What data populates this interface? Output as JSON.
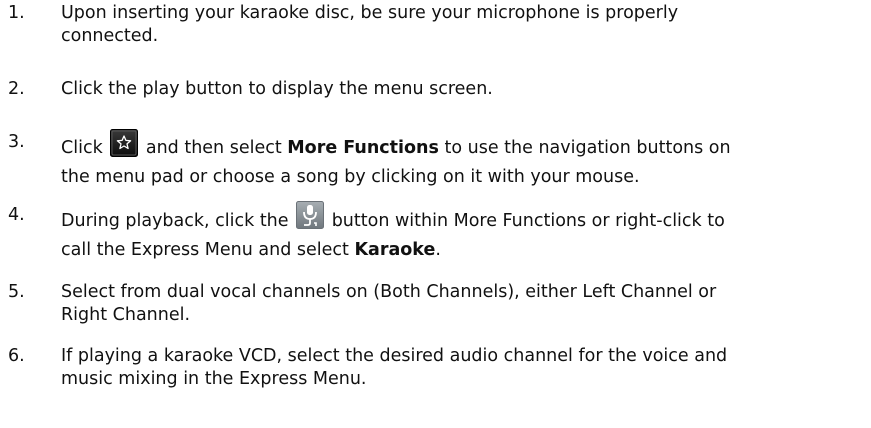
{
  "steps": [
    {
      "number": "1.",
      "line1": "Upon inserting your karaoke disc, be sure your microphone is properly",
      "line2": "connected."
    },
    {
      "number": "2.",
      "text": "Click the play button to display the menu screen."
    },
    {
      "number": "3.",
      "before_icon": "Click",
      "icon": "star-button-icon",
      "after_icon": " and then select ",
      "bold": "More Functions",
      "after_bold": " to use the navigation buttons on",
      "line2": "the menu pad or choose a song by clicking on it with your mouse."
    },
    {
      "number": "4.",
      "before_icon": "During playback, click the",
      "icon": "karaoke-microphone-icon",
      "after_icon": " button within More Functions or right-click to",
      "line2_before_bold": "call the Express Menu and select ",
      "bold": "Karaoke",
      "line2_after_bold": "."
    },
    {
      "number": "5.",
      "line1": "Select from dual vocal channels on (Both Channels), either Left Channel or",
      "line2": "Right Channel."
    },
    {
      "number": "6.",
      "line1": "If playing a karaoke VCD, select the desired audio channel for the voice and",
      "line2": "music mixing in the Express Menu."
    }
  ],
  "colors": {
    "text": "#111111",
    "icon_dark": "#1b1b1b",
    "icon_grey": "#8a9298"
  }
}
